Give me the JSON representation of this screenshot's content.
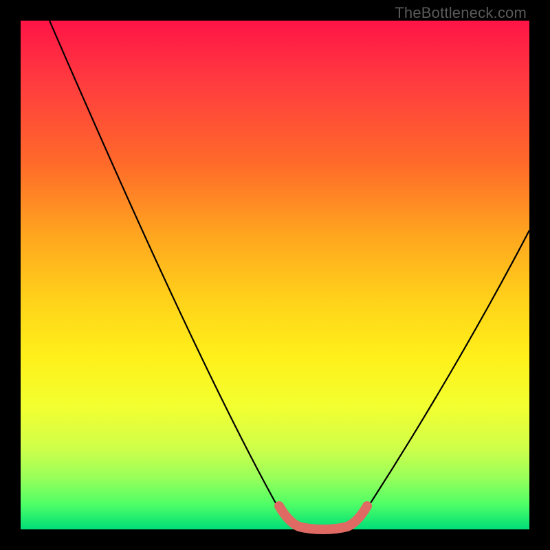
{
  "watermark": "TheBottleneck.com",
  "chart_data": {
    "type": "line",
    "title": "",
    "xlabel": "",
    "ylabel": "",
    "xlim": [
      0,
      100
    ],
    "ylim": [
      0,
      100
    ],
    "grid": false,
    "background_gradient": [
      "#ff1446",
      "#ff6a2a",
      "#ffd21a",
      "#f2ff30",
      "#00de77"
    ],
    "series": [
      {
        "name": "bottleneck-curve",
        "color": "#000000",
        "x": [
          5,
          10,
          15,
          20,
          25,
          30,
          35,
          40,
          45,
          50,
          54,
          58,
          62,
          66,
          70,
          75,
          80,
          85,
          90,
          95,
          100
        ],
        "y": [
          100,
          90,
          80,
          70,
          60,
          50,
          40,
          30,
          20,
          10,
          3,
          0,
          0,
          0,
          3,
          12,
          22,
          33,
          44,
          56,
          66
        ]
      },
      {
        "name": "optimal-region-highlight",
        "color": "#e0675f",
        "x": [
          54,
          58,
          62,
          66,
          70
        ],
        "y": [
          3,
          0,
          0,
          0,
          3
        ]
      }
    ],
    "annotations": []
  }
}
